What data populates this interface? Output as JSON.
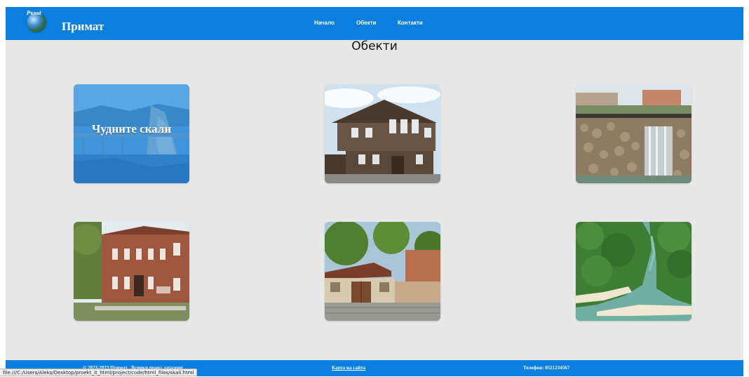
{
  "header": {
    "brand": "Примат",
    "logo_tag": "Ркsst",
    "nav": [
      {
        "label": "Начало"
      },
      {
        "label": "Обекти"
      },
      {
        "label": "Контакти"
      }
    ]
  },
  "main": {
    "title": "Обекти",
    "cards": [
      {
        "caption": "Чудните скали",
        "image": "bridge-over-reservoir-cliffs",
        "overlay": "#0a7fe0"
      },
      {
        "caption": "",
        "image": "wooden-revival-house"
      },
      {
        "caption": "",
        "image": "stone-waterfall-town"
      },
      {
        "caption": "",
        "image": "brick-museum-building"
      },
      {
        "caption": "",
        "image": "monastery-gate"
      },
      {
        "caption": "",
        "image": "river-delta-forest"
      }
    ]
  },
  "footer": {
    "copyright": "© 2023-2023 Примат . Всички права запазени",
    "sitemap_label": "Карта на сайта",
    "phone": "Телефон: 0521234567"
  },
  "status_bar": {
    "url": "file:///C:/Users/Aleks/Desktop/proekt_it_html/project/code/html_files/skali.html"
  },
  "colors": {
    "brand_blue": "#0a7fe0",
    "page_bg": "#e8e8e8"
  }
}
